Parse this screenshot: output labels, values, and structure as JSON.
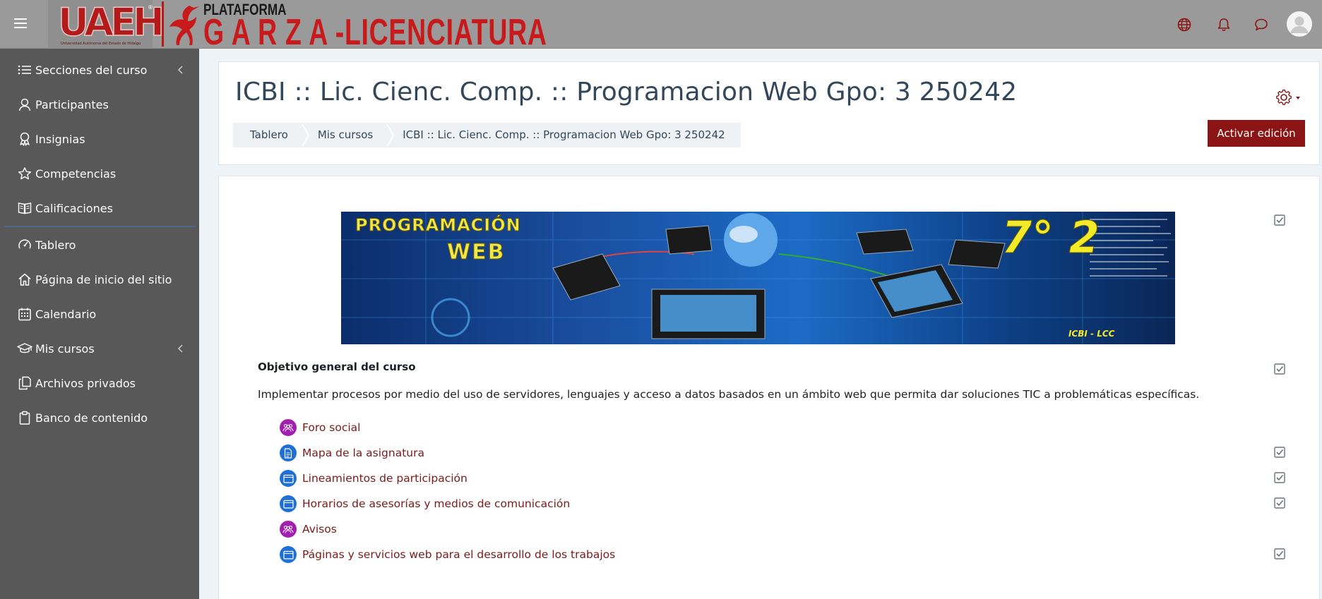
{
  "brand": {
    "logo_text": "UAEH",
    "logo_registered": "®",
    "logo_subtitle": "Universidad Autónoma del Estado de Hidalgo",
    "platform_label": "PLATAFORMA",
    "platform_name": "G A R Z A -LICENCIATURA"
  },
  "navbar": {
    "icons": [
      "globe-icon",
      "bell-icon",
      "chat-icon",
      "user-avatar"
    ]
  },
  "sidebar": {
    "items": [
      {
        "label": "Secciones del curso",
        "icon": "list-icon",
        "chevron": true
      },
      {
        "label": "Participantes",
        "icon": "user-icon",
        "chevron": false
      },
      {
        "label": "Insignias",
        "icon": "badge-icon",
        "chevron": false
      },
      {
        "label": "Competencias",
        "icon": "star-icon",
        "chevron": false
      },
      {
        "label": "Calificaciones",
        "icon": "grades-icon",
        "chevron": false
      },
      {
        "label": "Tablero",
        "icon": "dashboard-icon",
        "chevron": false
      },
      {
        "label": "Página de inicio del sitio",
        "icon": "home-icon",
        "chevron": false
      },
      {
        "label": "Calendario",
        "icon": "calendar-icon",
        "chevron": false
      },
      {
        "label": "Mis cursos",
        "icon": "graduation-cap-icon",
        "chevron": true
      },
      {
        "label": "Archivos privados",
        "icon": "files-icon",
        "chevron": false
      },
      {
        "label": "Banco de contenido",
        "icon": "clipboard-icon",
        "chevron": false
      }
    ]
  },
  "header": {
    "title": "ICBI :: Lic. Cienc. Comp. :: Programacion Web Gpo: 3 250242",
    "breadcrumb": [
      "Tablero",
      "Mis cursos",
      "ICBI :: Lic. Cienc. Comp. :: Programacion Web Gpo: 3 250242"
    ],
    "edit_button": "Activar edición"
  },
  "banner": {
    "line1": "PROGRAMACIÓN",
    "line2": "WEB",
    "number": "7° 2",
    "footer": "ICBI - LCC"
  },
  "section": {
    "objective_title": "Objetivo general del curso",
    "objective_text": "Implementar procesos por medio del uso de servidores, lenguajes y acceso a datos basados en un ámbito web que permita dar soluciones TIC a problemáticas específicas."
  },
  "activities": [
    {
      "label": "Foro social",
      "type": "forum",
      "color": "#a11eb0",
      "completion": false
    },
    {
      "label": "Mapa de la asignatura",
      "type": "file",
      "color": "#1f6fd6",
      "completion": true
    },
    {
      "label": "Lineamientos de participación",
      "type": "page",
      "color": "#1f6fd6",
      "completion": true
    },
    {
      "label": "Horarios de asesorías y medios de comunicación",
      "type": "page",
      "color": "#1f6fd6",
      "completion": true
    },
    {
      "label": "Avisos",
      "type": "forum",
      "color": "#a11eb0",
      "completion": false
    },
    {
      "label": "Páginas y servicios web para el desarrollo de los trabajos",
      "type": "page",
      "color": "#1f6fd6",
      "completion": true
    }
  ],
  "colors": {
    "navbar_bg": "#9a9a9a",
    "sidebar_bg": "#585858",
    "brand_red": "#c8191b",
    "edit_button_bg": "#8b1414",
    "link": "#7b1a1a"
  }
}
